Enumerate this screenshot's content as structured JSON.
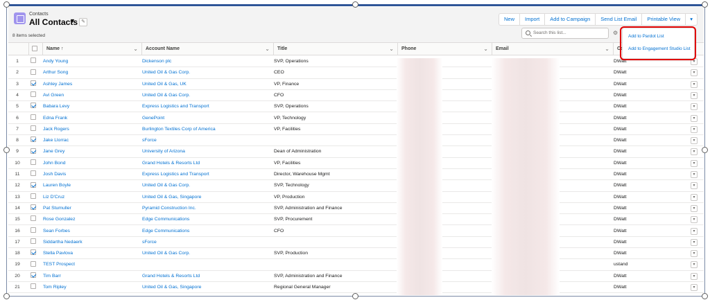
{
  "header": {
    "object_label": "Contacts",
    "list_title": "All Contacts",
    "title_chevron": "▼",
    "pin_icon": "✎",
    "items_selected": "8 items selected"
  },
  "actions": [
    "New",
    "Import",
    "Add to Campaign",
    "Send List Email",
    "Printable View"
  ],
  "actions_more": "▾",
  "search": {
    "placeholder": "Search this list..."
  },
  "gear_icon": "⚙",
  "dropdown": {
    "items": [
      "Add to Pardot List",
      "Add to Engagement Studio List"
    ]
  },
  "columns": {
    "name": "Name ↑",
    "account": "Account Name",
    "title": "Title",
    "phone": "Phone",
    "email": "Email",
    "owner": "Co"
  },
  "sort_chevron": "⌄",
  "row_action_icon": "▾",
  "rows": [
    {
      "num": "1",
      "checked": false,
      "name": "Andy Young",
      "account": "Dickenson plc",
      "title": "SVP, Operations",
      "owner": "DWatt"
    },
    {
      "num": "2",
      "checked": false,
      "name": "Arthur Song",
      "account": "United Oil & Gas Corp.",
      "title": "CEO",
      "owner": "DWatt"
    },
    {
      "num": "3",
      "checked": true,
      "name": "Ashley James",
      "account": "United Oil & Gas, UK",
      "title": "VP, Finance",
      "owner": "DWatt"
    },
    {
      "num": "4",
      "checked": false,
      "name": "Avi Green",
      "account": "United Oil & Gas Corp.",
      "title": "CFO",
      "owner": "DWatt"
    },
    {
      "num": "5",
      "checked": true,
      "name": "Babara Levy",
      "account": "Express Logistics and Transport",
      "title": "SVP, Operations",
      "owner": "DWatt"
    },
    {
      "num": "6",
      "checked": false,
      "name": "Edna Frank",
      "account": "GenePoint",
      "title": "VP, Technology",
      "owner": "DWatt"
    },
    {
      "num": "7",
      "checked": false,
      "name": "Jack Rogers",
      "account": "Burlington Textiles Corp of America",
      "title": "VP, Facilities",
      "owner": "DWatt"
    },
    {
      "num": "8",
      "checked": true,
      "name": "Jake Llorrac",
      "account": "sForce",
      "title": "",
      "owner": "DWatt"
    },
    {
      "num": "9",
      "checked": true,
      "name": "Jane Grey",
      "account": "University of Arizona",
      "title": "Dean of Administration",
      "owner": "DWatt"
    },
    {
      "num": "10",
      "checked": false,
      "name": "John Bond",
      "account": "Grand Hotels & Resorts Ltd",
      "title": "VP, Facilities",
      "owner": "DWatt"
    },
    {
      "num": "11",
      "checked": false,
      "name": "Josh Davis",
      "account": "Express Logistics and Transport",
      "title": "Director, Warehouse Mgmt",
      "owner": "DWatt"
    },
    {
      "num": "12",
      "checked": true,
      "name": "Lauren Boyle",
      "account": "United Oil & Gas Corp.",
      "title": "SVP, Technology",
      "owner": "DWatt"
    },
    {
      "num": "13",
      "checked": false,
      "name": "Liz D'Cruz",
      "account": "United Oil & Gas, Singapore",
      "title": "VP, Production",
      "owner": "DWatt"
    },
    {
      "num": "14",
      "checked": true,
      "name": "Pat Stumuller",
      "account": "Pyramid Construction Inc.",
      "title": "SVP, Administration and Finance",
      "owner": "DWatt"
    },
    {
      "num": "15",
      "checked": false,
      "name": "Rose Gonzalez",
      "account": "Edge Communications",
      "title": "SVP, Procurement",
      "owner": "DWatt"
    },
    {
      "num": "16",
      "checked": false,
      "name": "Sean Forbes",
      "account": "Edge Communications",
      "title": "CFO",
      "owner": "DWatt"
    },
    {
      "num": "17",
      "checked": false,
      "name": "Siddartha Nedaerk",
      "account": "sForce",
      "title": "",
      "owner": "DWatt"
    },
    {
      "num": "18",
      "checked": true,
      "name": "Stella Pavlova",
      "account": "United Oil & Gas Corp.",
      "title": "SVP, Production",
      "owner": "DWatt"
    },
    {
      "num": "19",
      "checked": false,
      "name": "TEST Prospect",
      "account": "",
      "title": "",
      "owner": "ustand"
    },
    {
      "num": "20",
      "checked": true,
      "name": "Tim Barr",
      "account": "Grand Hotels & Resorts Ltd",
      "title": "SVP, Administration and Finance",
      "owner": "DWatt"
    },
    {
      "num": "21",
      "checked": false,
      "name": "Tom Ripley",
      "account": "United Oil & Gas, Singapore",
      "title": "Regional General Manager",
      "owner": "DWatt"
    }
  ]
}
